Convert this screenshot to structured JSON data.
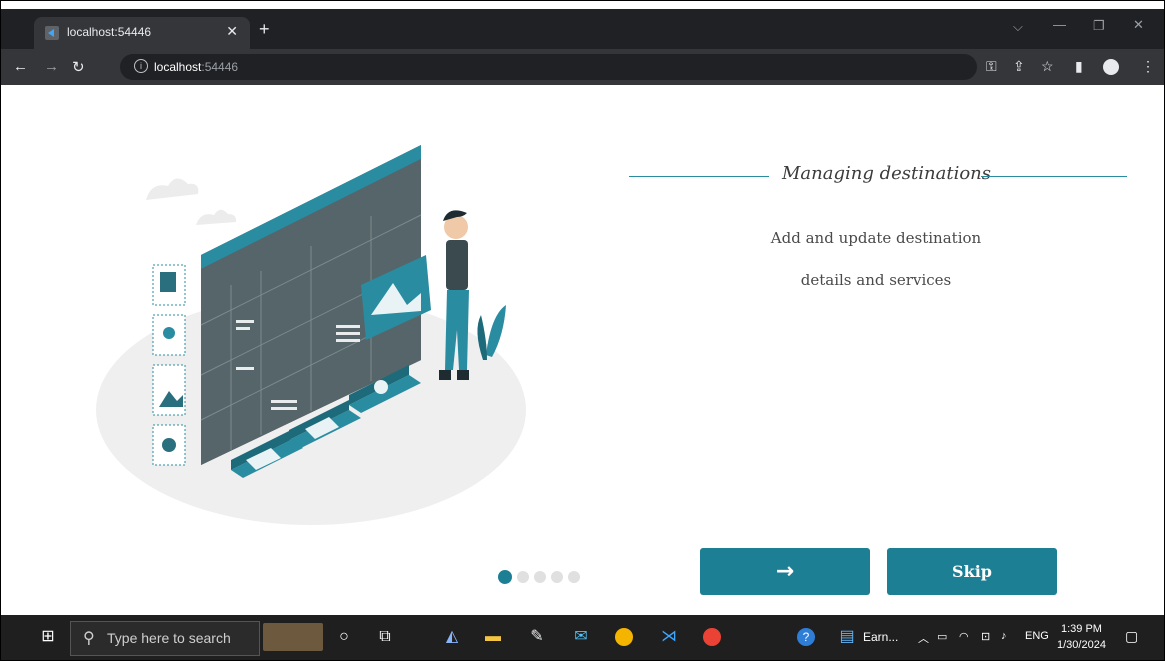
{
  "browser": {
    "tab_title": "localhost:54446",
    "url_host": "localhost",
    "url_port": ":54446",
    "url_scheme_icon": "info-icon"
  },
  "onboarding": {
    "heading": "Managing destinations",
    "description_line1": "Add and update destination",
    "description_line2": "details and services",
    "page_count": 5,
    "active_page": 1,
    "next_button_label": "→",
    "skip_button_label": "Skip",
    "accent_color": "#1d7f93"
  },
  "taskbar": {
    "search_placeholder": "Type here to search",
    "pinned_app_label": "Earn...",
    "language": "ENG",
    "time": "1:39 PM",
    "date": "1/30/2024"
  }
}
